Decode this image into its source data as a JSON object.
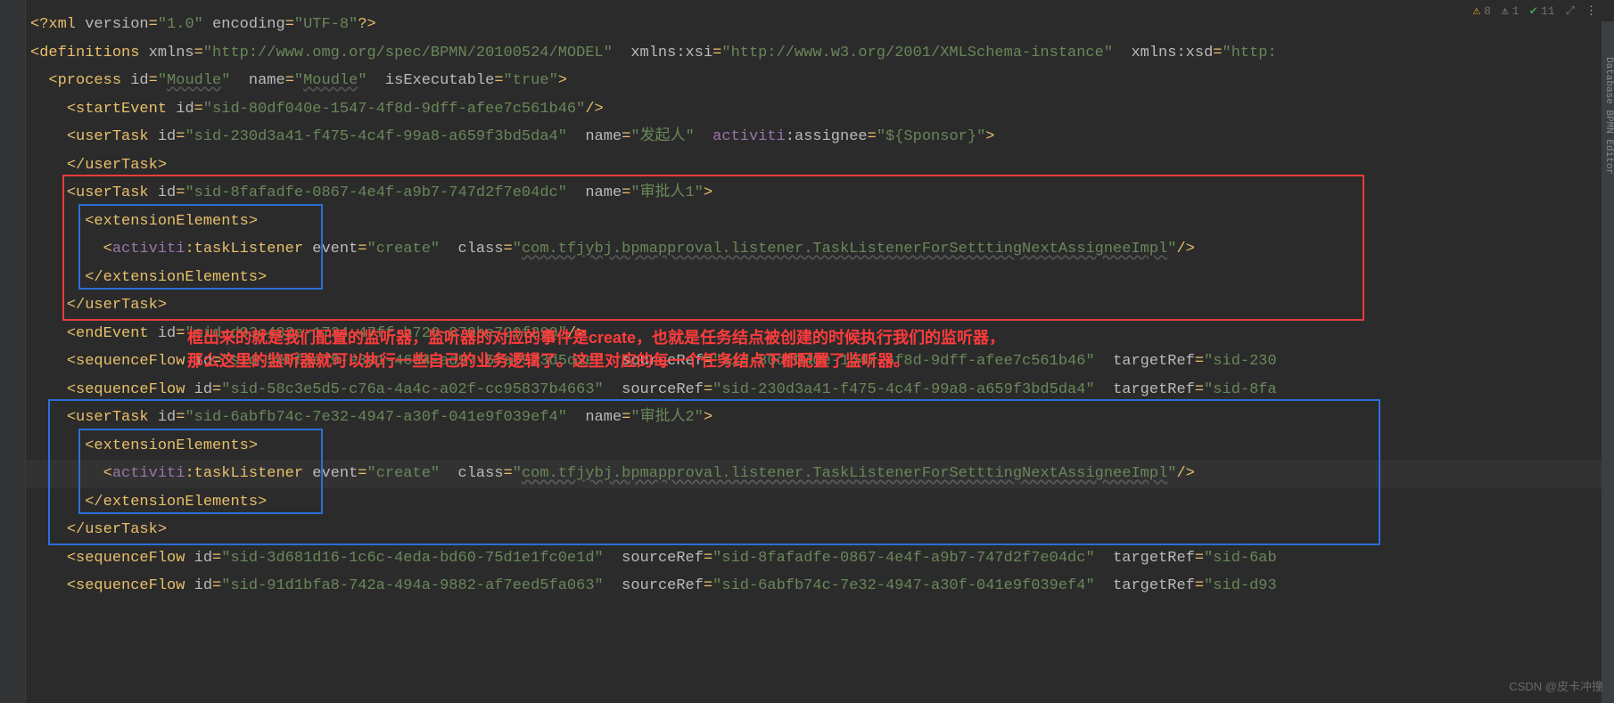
{
  "status": {
    "warn_count": "8",
    "weak_count": "1",
    "typo_count": "11"
  },
  "code": {
    "l1_xml": "<?xml version=\"1.0\" encoding=\"UTF-8\"?>",
    "l2_defs": "definitions",
    "l2_xmlns": "xmlns",
    "l2_xmlns_val": "http://www.omg.org/spec/BPMN/20100524/MODEL",
    "l2_xsi": "xmlns:xsi",
    "l2_xsi_val": "http://www.w3.org/2001/XMLSchema-instance",
    "l2_xsd": "xmlns:xsd",
    "l2_xsd_val": "http:",
    "l3_process": "process",
    "l3_id": "id",
    "l3_id_val": "Moudle",
    "l3_name": "name",
    "l3_name_val": "Moudle",
    "l3_exec": "isExecutable",
    "l3_exec_val": "true",
    "l4_start": "startEvent",
    "l4_id_val": "sid-80df040e-1547-4f8d-9dff-afee7c561b46",
    "l5_userTask": "userTask",
    "l5_id_val": "sid-230d3a41-f475-4c4f-99a8-a659f3bd5da4",
    "l5_name_val": "发起人",
    "l5_assignee": "activiti:assignee",
    "l5_assignee_val": "${Sponsor}",
    "l6_close": "</userTask>",
    "l7_id_val": "sid-8fafadfe-0867-4e4f-a9b7-747d2f7e04dc",
    "l7_name_val": "审批人1",
    "l8_ext": "extensionElements",
    "l9_tl": "activiti:taskListener",
    "l9_event": "event",
    "l9_event_val": "create",
    "l9_class": "class",
    "l9_class_val": "com.tfjybj.bpmapproval.listener.TaskListenerForSetttingNextAssigneeImpl",
    "l10_close": "</extensionElements>",
    "l11_close": "</userTask>",
    "l12_end": "endEvent",
    "l12_id_val": "sid-d93c482e-1734-47ff-b726-870be729f290",
    "l13_sf": "sequenceFlow",
    "l13_id_val": "sid-5e0f1e79-e3e1-46d4-ad97-5fa6973d5d2e",
    "l13_src": "sourceRef",
    "l13_src_val": "sid-80df040e-1547-4f8d-9dff-afee7c561b46",
    "l13_tgt": "targetRef",
    "l13_tgt_val": "sid-230",
    "l14_id_val": "sid-58c3e5d5-c76a-4a4c-a02f-cc95837b4663",
    "l14_src_val": "sid-230d3a41-f475-4c4f-99a8-a659f3bd5da4",
    "l14_tgt_val": "sid-8fa",
    "l15_id_val": "sid-6abfb74c-7e32-4947-a30f-041e9f039ef4",
    "l15_name_val": "审批人2",
    "l20_id_val": "sid-3d681d16-1c6c-4eda-bd60-75d1e1fc0e1d",
    "l20_src_val": "sid-8fafadfe-0867-4e4f-a9b7-747d2f7e04dc",
    "l20_tgt_val": "sid-6ab",
    "l21_id_val": "sid-91d1bfa8-742a-494a-9882-af7eed5fa063",
    "l21_src_val": "sid-6abfb74c-7e32-4947-a30f-041e9f039ef4",
    "l21_tgt_val": "sid-d93"
  },
  "annotation": {
    "line1": "框出来的就是我们配置的监听器，监听器的对应的事件是create，也就是任务结点被创建的时候执行我们的监听器，",
    "line2": "那么这里的监听器就可以执行一些自己的业务逻辑了。这里对应的每一个任务结点下都配置了监听器。"
  },
  "watermark": "CSDN @皮卡冲撞"
}
